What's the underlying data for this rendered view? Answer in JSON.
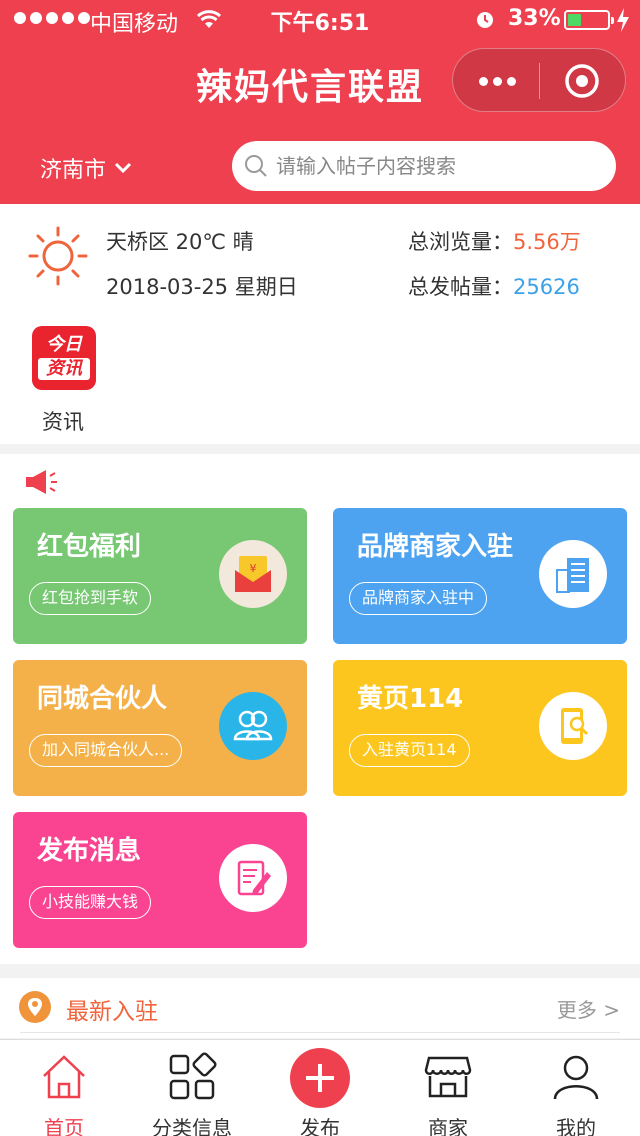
{
  "status_bar": {
    "carrier": "中国移动",
    "time": "下午6:51",
    "battery": "33%",
    "battery_level": 0.33
  },
  "header": {
    "title": "辣妈代言联盟",
    "city": "济南市",
    "search_placeholder": "请输入帖子内容搜索"
  },
  "info": {
    "weather": "天桥区 20℃ 晴",
    "date": "2018-03-25 星期日",
    "views_label": "总浏览量：",
    "views_value": "5.56万",
    "posts_label": "总发帖量：",
    "posts_value": "25626",
    "news_icon_top": "今日",
    "news_icon_bottom": "资讯",
    "news_label": "资讯"
  },
  "cards": [
    {
      "title": "红包福利",
      "pill": "红包抢到手软",
      "color": "#77c773",
      "icon": "red-envelope-icon"
    },
    {
      "title": "品牌商家入驻",
      "pill": "品牌商家入驻中",
      "color": "#4da3f0",
      "icon": "building-icon"
    },
    {
      "title": "同城合伙人",
      "pill": "加入同城合伙人...",
      "color": "#f4b14a",
      "icon": "partners-icon"
    },
    {
      "title": "黄页114",
      "pill": "入驻黄页114",
      "color": "#fdc61f",
      "icon": "phone-search-icon"
    },
    {
      "title": "发布消息",
      "pill": "小技能赚大钱",
      "color": "#fb4491",
      "icon": "edit-note-icon"
    }
  ],
  "latest": {
    "title": "最新入驻",
    "more": "更多 >"
  },
  "tabbar": {
    "items": [
      {
        "label": "首页",
        "icon": "home-icon"
      },
      {
        "label": "分类信息",
        "icon": "category-icon"
      },
      {
        "label": "发布",
        "icon": "plus-icon"
      },
      {
        "label": "商家",
        "icon": "store-icon"
      },
      {
        "label": "我的",
        "icon": "user-icon"
      }
    ]
  },
  "colors": {
    "brand": "#ee404f",
    "views": "#f0643c",
    "posts": "#3ba1e8"
  }
}
